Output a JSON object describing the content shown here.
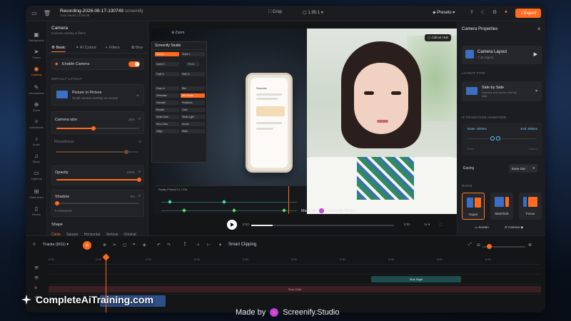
{
  "topbar": {
    "title": "Recording-2026-06-17-130749",
    "app": "screenify",
    "saved": "Auto saved 12:58:09",
    "crop": "Crop",
    "ratio": "1.95:1",
    "presets": "Presets",
    "export": "Export"
  },
  "rail": [
    "Background",
    "Cursor",
    "Camera",
    "Annotations",
    "Zoom",
    "Animations",
    "Audio",
    "Music",
    "Captions",
    "Watermark",
    "Device"
  ],
  "left": {
    "title": "Camera",
    "subtitle": "Camera overlay & filters",
    "tabs": [
      "Basic",
      "AI Cutout",
      "Filters",
      "Bea"
    ],
    "enable": "Enable Camera",
    "layout_section": "DEFAULT LAYOUT",
    "layout_name": "Picture in Picture",
    "layout_desc": "Small camera overlay on screen",
    "size_label": "Camera size",
    "size_val": "25%",
    "size_pct": 0.45,
    "round_label": "Roundness",
    "round_pct": 0.85,
    "opacity_label": "Opacity",
    "opacity_val": "100%",
    "opacity_pct": 1.0,
    "shadow_label": "Shadow",
    "shadow_val": "0%",
    "advanced": "Advanced",
    "shape_label": "Shape",
    "shapes": [
      "Circle",
      "Square",
      "Horizontal",
      "Vertical",
      "Original"
    ]
  },
  "stage": {
    "zoom": "Zoom",
    "callout": "Callout Hub",
    "mini_title": "Screenify Studio",
    "mini_rows": [
      "Scenes",
      "Scene 1",
      "Scene 2",
      "Effects",
      "Fade In",
      "Slide In",
      "Zoom In",
      "Blur",
      "Showcase",
      "Neo Center",
      "Carousel",
      "Pendulum",
      "Breathe",
      "Calm",
      "Studio Dark",
      "Studio Light",
      "Neon Glow",
      "Aurora",
      "Indigo",
      "Black"
    ],
    "phone_title": "Sources",
    "madeby": "Made by",
    "brand": "Screenify.Studio",
    "time_start": "0:03",
    "time_end": "0:31",
    "speed": "1x",
    "mini_controls": "Replay  Present  3.1 / 0.9s"
  },
  "right": {
    "title": "Camera Properties",
    "layout_title": "Camera Layout",
    "layout_sub": "7.4s region",
    "layout_type": "LAYOUT TYPE",
    "lt_name": "Side by Side",
    "lt_desc": "Camera and screen side by side",
    "trans": "TRANSITION ANIMATION",
    "enter": "Enter: 600ms",
    "exit": "Exit: 600ms",
    "enter_tag": "Enter",
    "exit_tag": "Return",
    "easing": "Easing",
    "ease_val": "Ease Out",
    "ratio": "RATIO",
    "ratios": [
      "Equal",
      "Main/Sub",
      "Focus"
    ],
    "screen": "Screen",
    "camera": "Camera"
  },
  "timeline": {
    "tracks": "Tracks (9/11)",
    "smart": "Smart Clipping",
    "ticks": [
      "0:00",
      "0:05",
      "0:10",
      "0:15",
      "0:20",
      "0:25",
      "0:30",
      "0:35",
      "0:40",
      "0:45"
    ],
    "clip_teal": "Side Right",
    "clip_red": "Slow Orbit"
  },
  "overlay": {
    "watermark": "CompleteAiTraining.com",
    "madeby": "Made by",
    "brand": "Screenify.Studio"
  },
  "colors": {
    "accent": "#ff6a1f",
    "blue": "#3b6fc4",
    "teal": "#3ddcc4"
  }
}
